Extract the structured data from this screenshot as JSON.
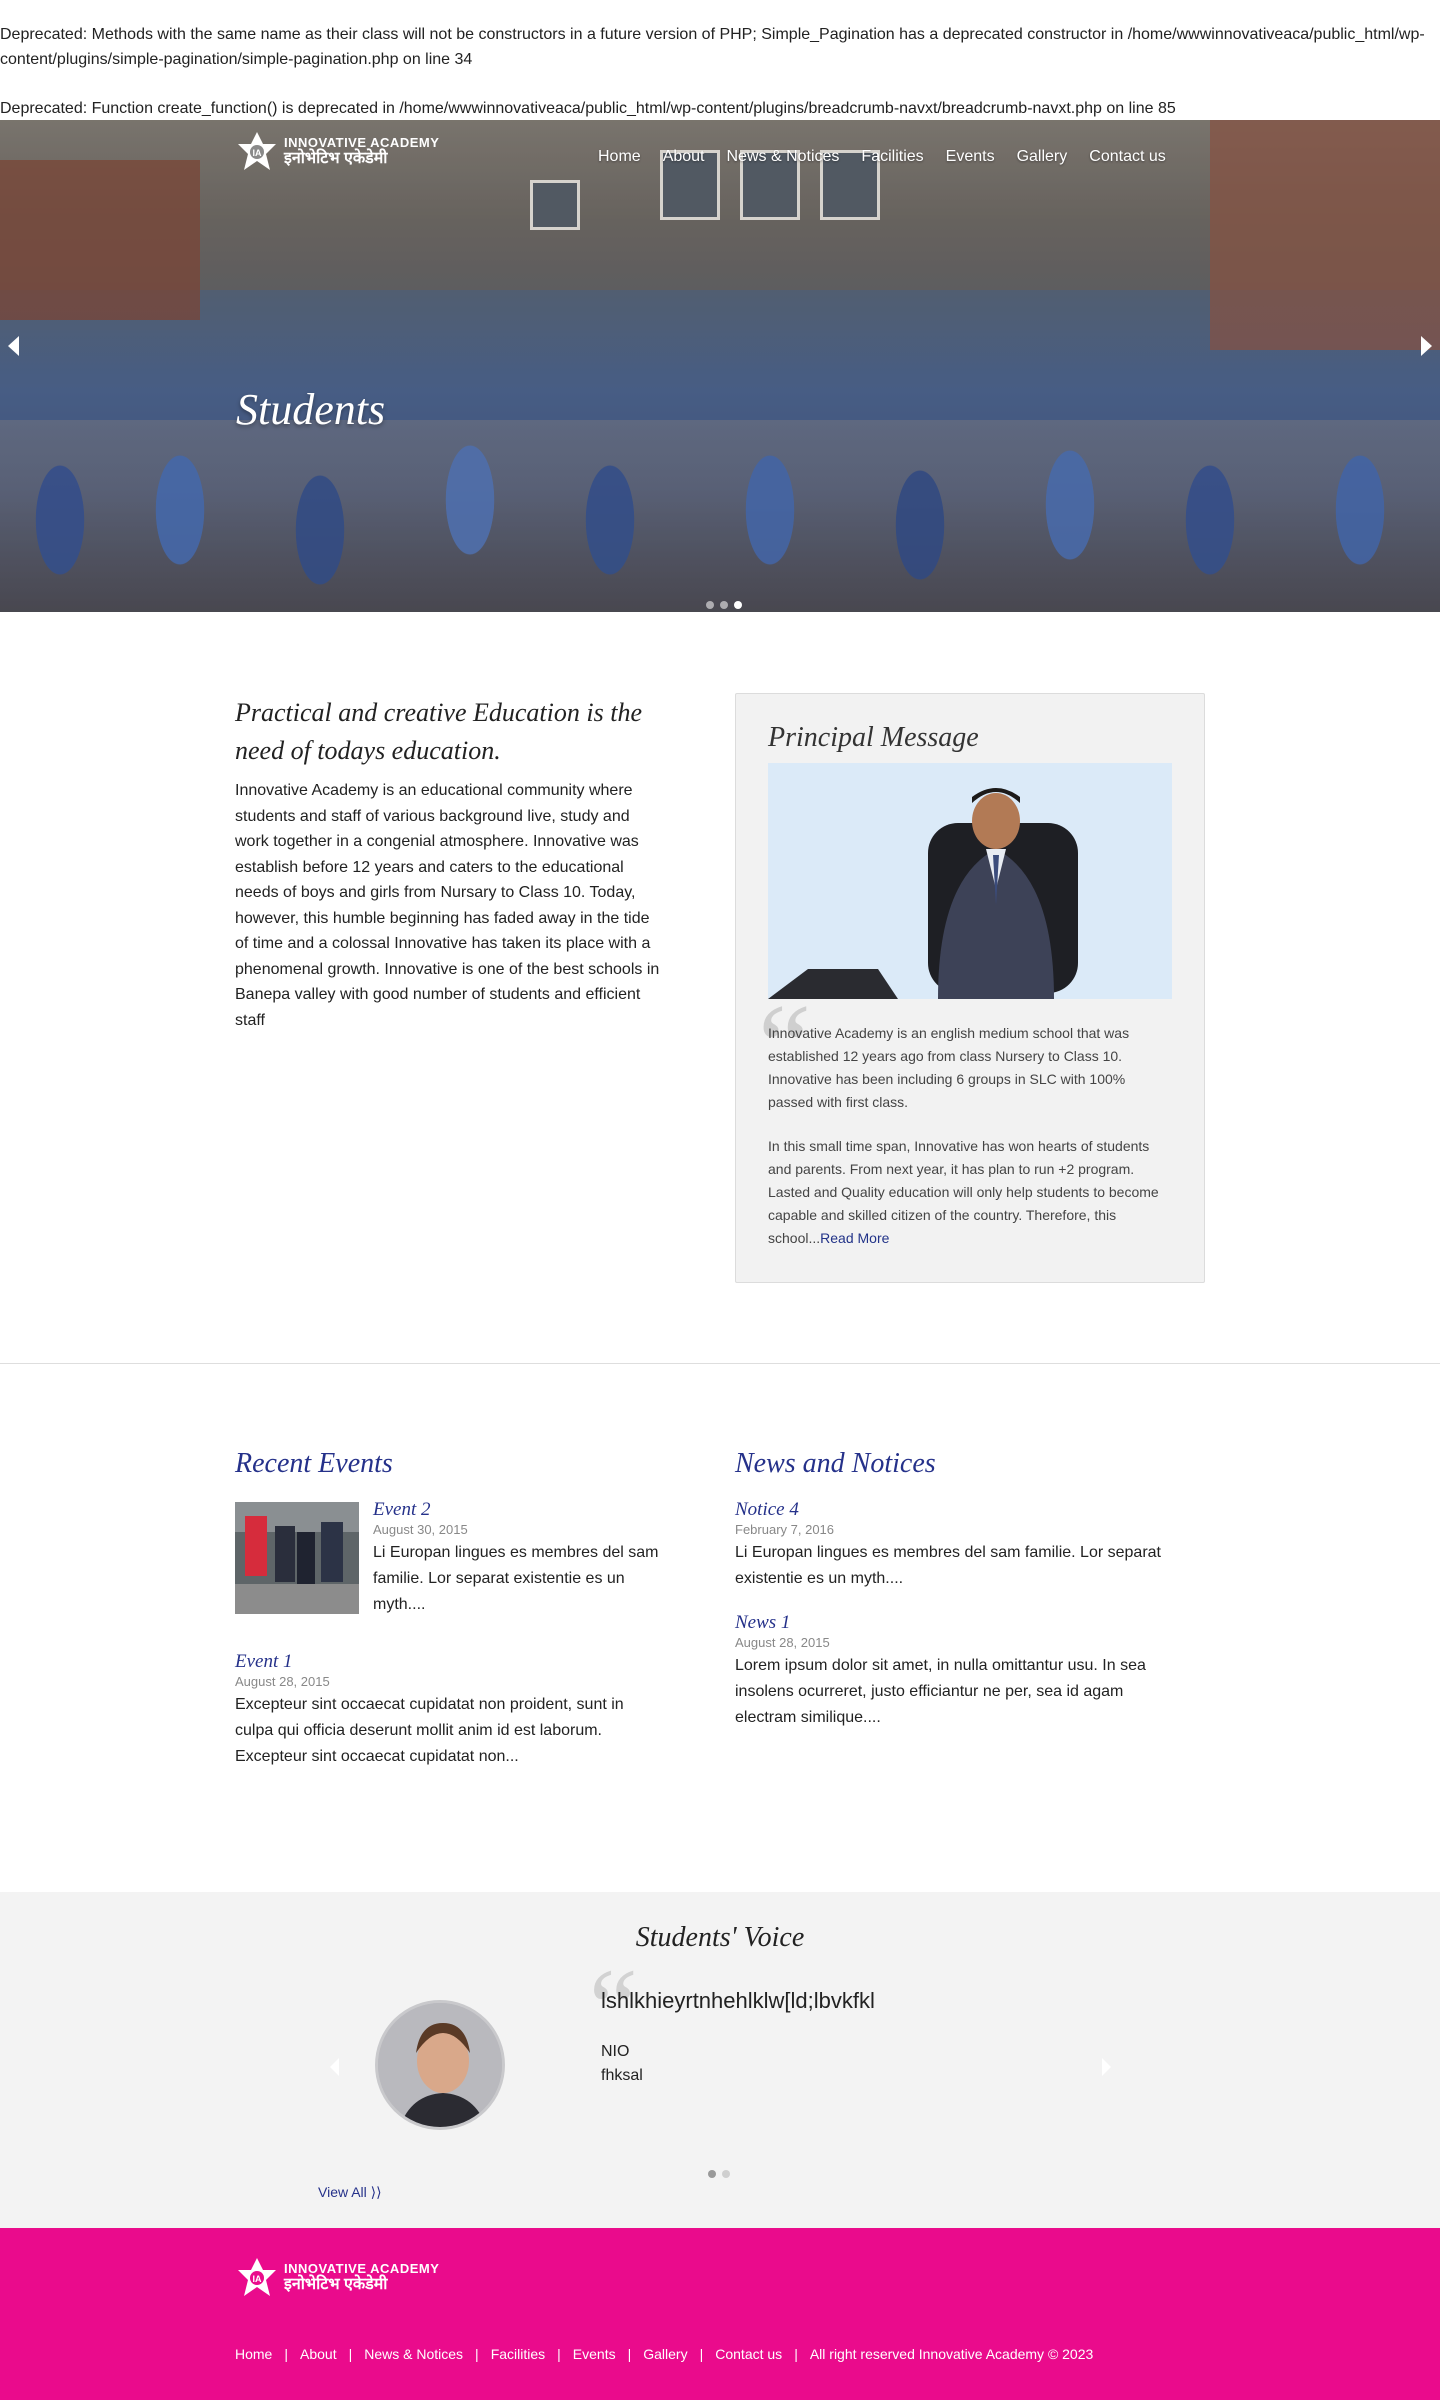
{
  "warnings": [
    "Deprecated: Methods with the same name as their class will not be constructors in a future version of PHP; Simple_Pagination has a deprecated constructor in /home/wwwinnovativeaca/public_html/wp-content/plugins/simple-pagination/simple-pagination.php on line 34",
    "Deprecated: Function create_function() is deprecated in /home/wwwinnovativeaca/public_html/wp-content/plugins/breadcrumb-navxt/breadcrumb-navxt.php on line 85"
  ],
  "brand": {
    "name_en": "INNOVATIVE ACADEMY",
    "name_np": "इनोभेटिभ एकेडेमी"
  },
  "nav": [
    "Home",
    "About",
    "News & Notices",
    "Facilities",
    "Events",
    "Gallery",
    "Contact us"
  ],
  "hero": {
    "caption": "Students",
    "slide_count": 3,
    "active_slide": 3
  },
  "intro": {
    "heading": "Practical and creative Education is the need of todays education.",
    "body": "Innovative Academy is an educational community where students and staff of various background live, study and work together in a congenial atmosphere. Innovative was establish before 12 years and caters to the educational needs of boys and girls from Nursary to Class 10. Today, however, this humble beginning has faded away in the tide of time and a colossal Innovative has taken its place with a phenomenal growth. Innovative is one of the best schools in Banepa valley with good number of students and efficient staff"
  },
  "principal": {
    "title": "Principal Message",
    "para1": "Innovative Academy is an english medium school that was established 12 years ago from class Nursery to Class 10.  Innovative has been including 6 groups in SLC with 100% passed with first class.",
    "para2": "In this small time span, Innovative has won hearts of students and parents. From next year, it has plan to run +2 program. Lasted and Quality education will only help students to become capable and skilled citizen of the country. Therefore, this school...",
    "read_more": "Read More"
  },
  "events": {
    "title": "Recent Events",
    "items": [
      {
        "title": "Event 2",
        "date": "August 30, 2015",
        "text": "Li Europan lingues es membres del sam familie. Lor separat existentie es un myth...."
      },
      {
        "title": "Event 1",
        "date": "August 28, 2015",
        "text": "Excepteur sint occaecat cupidatat non proident, sunt in culpa qui officia deserunt mollit anim id est laborum. Excepteur sint occaecat cupidatat non..."
      }
    ]
  },
  "news": {
    "title": "News and Notices",
    "items": [
      {
        "title": "Notice 4",
        "date": "February 7, 2016",
        "text": "Li Europan lingues es membres del sam familie. Lor separat existentie es un myth...."
      },
      {
        "title": "News 1",
        "date": "August 28, 2015",
        "text": "Lorem ipsum dolor sit amet, in nulla omittantur usu. In sea insolens ocurreret, justo efficiantur ne per, sea id agam electram similique...."
      }
    ]
  },
  "voice": {
    "title": "Students' Voice",
    "quote": "lshlkhieyrtnhehlklw[ld;lbvkfkl",
    "name_line1": "NIO",
    "name_line2": "fhksal",
    "view_all": "View All ⟩⟩",
    "slide_count": 2,
    "active_slide": 1
  },
  "footer": {
    "links": [
      "Home",
      "About",
      "News & Notices",
      "Facilities",
      "Events",
      "Gallery",
      "Contact us"
    ],
    "copyright": "All right reserved Innovative Academy © 2023"
  },
  "colors": {
    "accent_blue": "#25318a",
    "footer_pink": "#ea0b8c"
  }
}
